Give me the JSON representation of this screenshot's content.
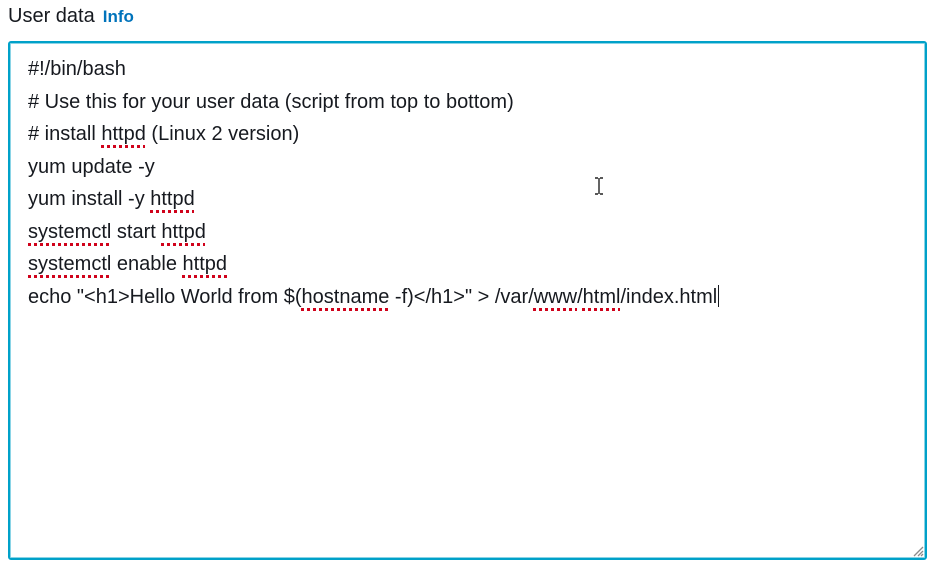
{
  "field": {
    "label": "User data",
    "info_link": "Info"
  },
  "editor": {
    "lines": [
      [
        {
          "t": "#!/bin/bash"
        }
      ],
      [
        {
          "t": "# Use this for your user data (script from top to bottom)"
        }
      ],
      [
        {
          "t": "# install "
        },
        {
          "t": "httpd",
          "sp": true
        },
        {
          "t": " (Linux 2 version)"
        }
      ],
      [
        {
          "t": "yum update -y"
        }
      ],
      [
        {
          "t": "yum install -y "
        },
        {
          "t": "httpd",
          "sp": true
        }
      ],
      [
        {
          "t": "systemctl",
          "sp": true
        },
        {
          "t": " start "
        },
        {
          "t": "httpd",
          "sp": true
        }
      ],
      [
        {
          "t": "systemctl",
          "sp": true
        },
        {
          "t": " enable "
        },
        {
          "t": "httpd",
          "sp": true
        }
      ],
      [
        {
          "t": "echo \"<h1>Hello World from $("
        },
        {
          "t": "hostname",
          "sp": true
        },
        {
          "t": " -f)</h1>\" > /var/"
        },
        {
          "t": "www",
          "sp": true
        },
        {
          "t": "/"
        },
        {
          "t": "html",
          "sp": true
        },
        {
          "t": "/index.html"
        }
      ]
    ],
    "spellcheck_color": "#d0021b",
    "focus_border_color": "#00a1c9"
  },
  "icons": {
    "cursor": "text-cursor-icon",
    "resize": "resize-grip-icon"
  }
}
